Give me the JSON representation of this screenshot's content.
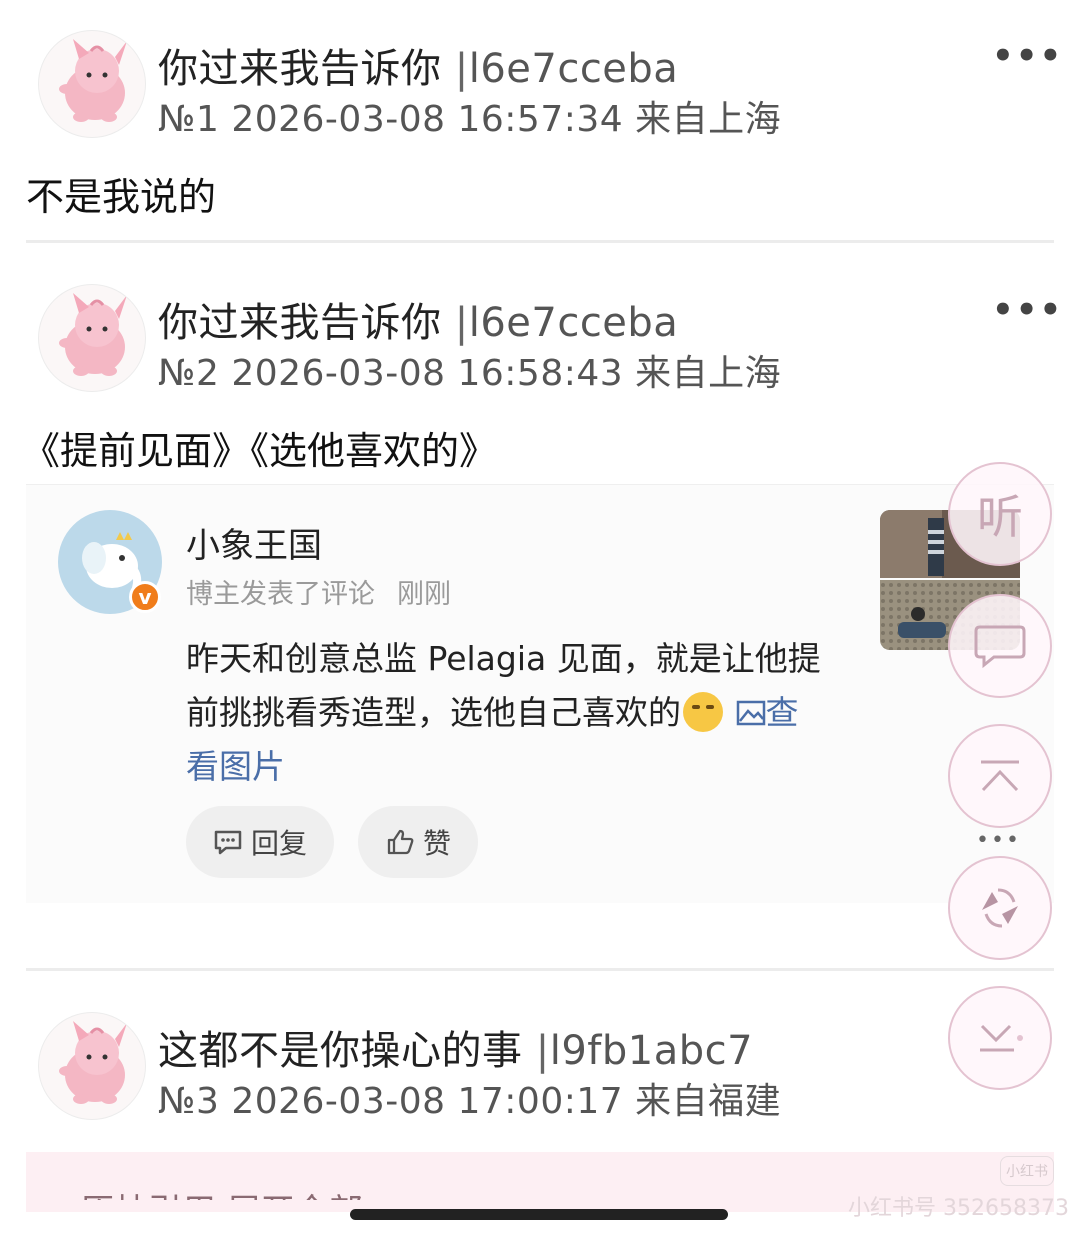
{
  "posts": [
    {
      "username": "你过来我告诉你",
      "user_id": "l6e7cceba",
      "floor": "№1",
      "timestamp": "2026-03-08 16:57:34",
      "location": "来自上海",
      "content": "不是我说的"
    },
    {
      "username": "你过来我告诉你",
      "user_id": "l6e7cceba",
      "floor": "№2",
      "timestamp": "2026-03-08 16:58:43",
      "location": "来自上海",
      "content": "《提前见面》《选他喜欢的》"
    },
    {
      "username": "这都不是你操心的事",
      "user_id": "l9fb1abc7",
      "floor": "№3",
      "timestamp": "2026-03-08 17:00:17",
      "location": "来自福建"
    }
  ],
  "more_label": "•••",
  "quoted_card": {
    "author": "小象王国",
    "verified_badge": "v",
    "action": "博主发表了评论",
    "time": "刚刚",
    "line1": "昨天和创意总监 Pelagia 见面，就是让他提",
    "line2": "前挑挑看秀造型，选他自己喜欢的",
    "view_images_label": "查",
    "view_images_label2": "看图片",
    "reply_label": "回复",
    "like_label": "赞"
  },
  "floating_buttons": {
    "listen_label": "听"
  },
  "quote_preview": "原帖引用 展开全部",
  "watermark": {
    "text": "小红书号 352658373",
    "tag": "小红书"
  },
  "icons": [
    "more-icon",
    "chat-icon",
    "thumb-up-icon",
    "image-icon",
    "comment-icon",
    "scroll-top-icon",
    "refresh-icon",
    "download-icon"
  ],
  "colors": {
    "accent_link": "#4a6ea8",
    "badge_orange": "#f07d1b",
    "fab_border": "#e4c3d1"
  }
}
